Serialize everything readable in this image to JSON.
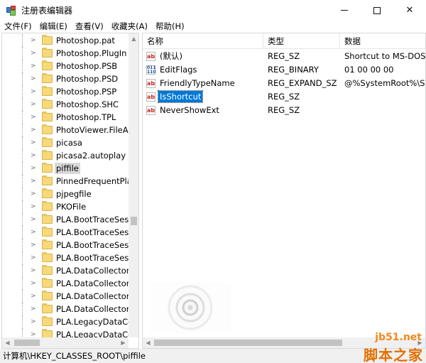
{
  "window": {
    "title": "注册表编辑器",
    "controls": {
      "minimize": "",
      "maximize": "",
      "close": "✕"
    }
  },
  "menu": {
    "items": [
      "文件(F)",
      "编辑(E)",
      "查看(V)",
      "收藏夹(A)",
      "帮助(H)"
    ]
  },
  "tree": {
    "items": [
      {
        "label": "Photoshop.pat"
      },
      {
        "label": "Photoshop.PlugIn"
      },
      {
        "label": "Photoshop.PSB"
      },
      {
        "label": "Photoshop.PSD"
      },
      {
        "label": "Photoshop.PSP"
      },
      {
        "label": "Photoshop.SHC"
      },
      {
        "label": "Photoshop.TPL"
      },
      {
        "label": "PhotoViewer.FileAss"
      },
      {
        "label": "picasa"
      },
      {
        "label": "picasa2.autoplay"
      },
      {
        "label": "piffile",
        "selected": true
      },
      {
        "label": "PinnedFrequentPlac"
      },
      {
        "label": "pjpegfile"
      },
      {
        "label": "PKOFile"
      },
      {
        "label": "PLA.BootTraceSessi"
      },
      {
        "label": "PLA.BootTraceSessi"
      },
      {
        "label": "PLA.BootTraceSessi"
      },
      {
        "label": "PLA.BootTraceSessi"
      },
      {
        "label": "PLA.DataCollectorSe"
      },
      {
        "label": "PLA.DataCollectorSe"
      },
      {
        "label": "PLA.DataCollectorSe"
      },
      {
        "label": "PLA.DataCollectorSe"
      },
      {
        "label": "PLA.LegacyDataColl"
      },
      {
        "label": "PLA.LegacyDataColl"
      }
    ]
  },
  "list": {
    "columns": [
      "名称",
      "类型",
      "数据"
    ],
    "rows": [
      {
        "icon": "string-value-icon",
        "name": "(默认)",
        "type": "REG_SZ",
        "data": "Shortcut to MS-DOS P"
      },
      {
        "icon": "binary-value-icon",
        "name": "EditFlags",
        "type": "REG_BINARY",
        "data": "01 00 00 00"
      },
      {
        "icon": "string-value-icon",
        "name": "FriendlyTypeName",
        "type": "REG_EXPAND_SZ",
        "data": "@%SystemRoot%\\Sys"
      },
      {
        "icon": "string-value-icon",
        "name": "IsShortcut",
        "type": "REG_SZ",
        "data": "",
        "selected": true
      },
      {
        "icon": "string-value-icon",
        "name": "NeverShowExt",
        "type": "REG_SZ",
        "data": ""
      }
    ]
  },
  "status": {
    "path": "计算机\\HKEY_CLASSES_ROOT\\piffile"
  },
  "watermark": {
    "line1": "jb51.net",
    "line2": "脚本之家"
  },
  "colors": {
    "selection": "#0078d7",
    "folder": "#f6d97a",
    "watermark": "#e36f00"
  }
}
